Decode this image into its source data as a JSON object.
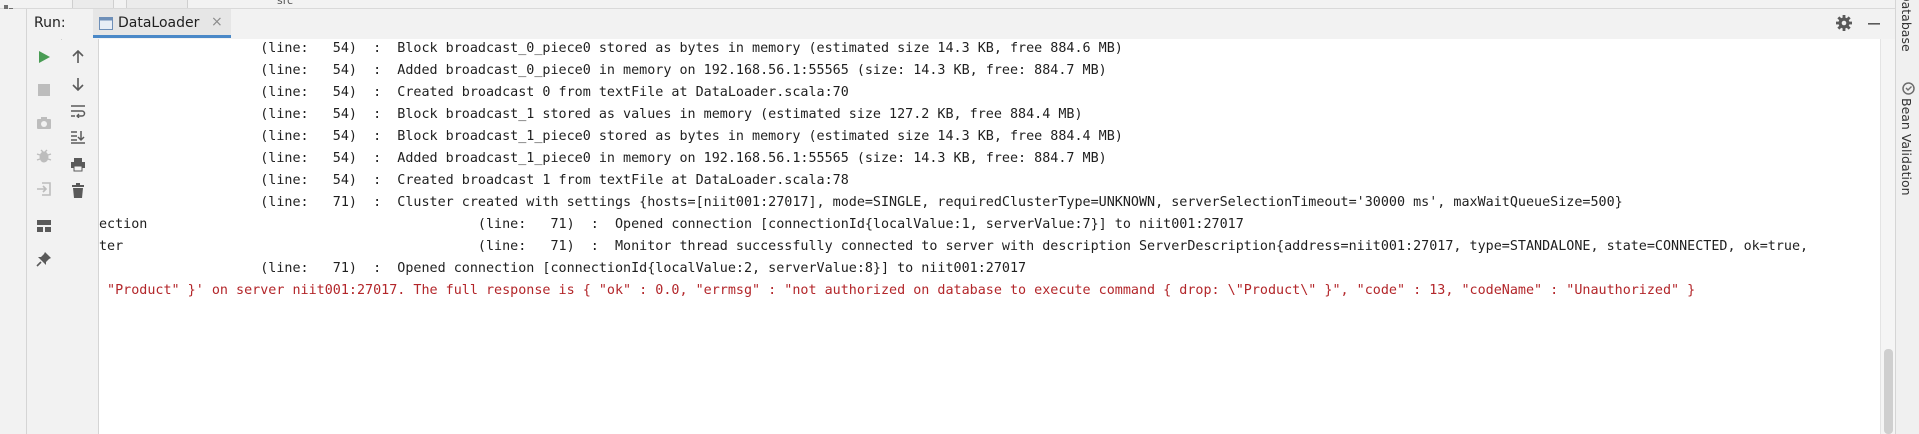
{
  "top_strip": {
    "fragment_text": "src"
  },
  "run_panel": {
    "label": "Run:",
    "tab": {
      "label": "DataLoader",
      "close_glyph": "×"
    }
  },
  "toolbar": {
    "col1": [
      "play-icon",
      "stop-icon",
      "camera-icon",
      "bug-icon",
      "login-icon",
      "layout-icon",
      "pin-icon"
    ],
    "col2": [
      "arrow-up-icon",
      "arrow-down-icon",
      "soft-wrap-icon",
      "scroll-to-end-icon",
      "print-icon",
      "trash-icon"
    ]
  },
  "console": {
    "lines": [
      {
        "text": "                    (line:   54)  :  Block broadcast_0_piece0 stored as bytes in memory (estimated size 14.3 KB, free 884.6 MB)",
        "type": "info"
      },
      {
        "text": "                    (line:   54)  :  Added broadcast_0_piece0 in memory on 192.168.56.1:55565 (size: 14.3 KB, free: 884.7 MB)",
        "type": "info"
      },
      {
        "text": "                    (line:   54)  :  Created broadcast 0 from textFile at DataLoader.scala:70",
        "type": "info"
      },
      {
        "text": "                    (line:   54)  :  Block broadcast_1 stored as values in memory (estimated size 127.2 KB, free 884.4 MB)",
        "type": "info"
      },
      {
        "text": "                    (line:   54)  :  Block broadcast_1_piece0 stored as bytes in memory (estimated size 14.3 KB, free 884.4 MB)",
        "type": "info"
      },
      {
        "text": "                    (line:   54)  :  Added broadcast_1_piece0 in memory on 192.168.56.1:55565 (size: 14.3 KB, free: 884.7 MB)",
        "type": "info"
      },
      {
        "text": "                    (line:   54)  :  Created broadcast 1 from textFile at DataLoader.scala:78",
        "type": "info"
      },
      {
        "text": "                    (line:   71)  :  Cluster created with settings {hosts=[niit001:27017], mode=SINGLE, requiredClusterType=UNKNOWN, serverSelectionTimeout='30000 ms', maxWaitQueueSize=500}",
        "type": "info"
      },
      {
        "text": "ection                                         (line:   71)  :  Opened connection [connectionId{localValue:1, serverValue:7}] to niit001:27017",
        "type": "info"
      },
      {
        "text": "ter                                            (line:   71)  :  Monitor thread successfully connected to server with description ServerDescription{address=niit001:27017, type=STANDALONE, state=CONNECTED, ok=true,",
        "type": "info"
      },
      {
        "text": "                    (line:   71)  :  Opened connection [connectionId{localValue:2, serverValue:8}] to niit001:27017",
        "type": "info"
      },
      {
        "text": " \"Product\" }' on server niit001:27017. The full response is { \"ok\" : 0.0, \"errmsg\" : \"not authorized on database to execute command { drop: \\\"Product\\\" }\", \"code\" : 13, \"codeName\" : \"Unauthorized\" }",
        "type": "error"
      }
    ]
  },
  "right_sidebar": {
    "database_label": "Database",
    "bean_label": "Bean Validation"
  },
  "colors": {
    "accent": "#4a88c7",
    "error_text": "#b3262a",
    "run_green": "#499c54"
  }
}
